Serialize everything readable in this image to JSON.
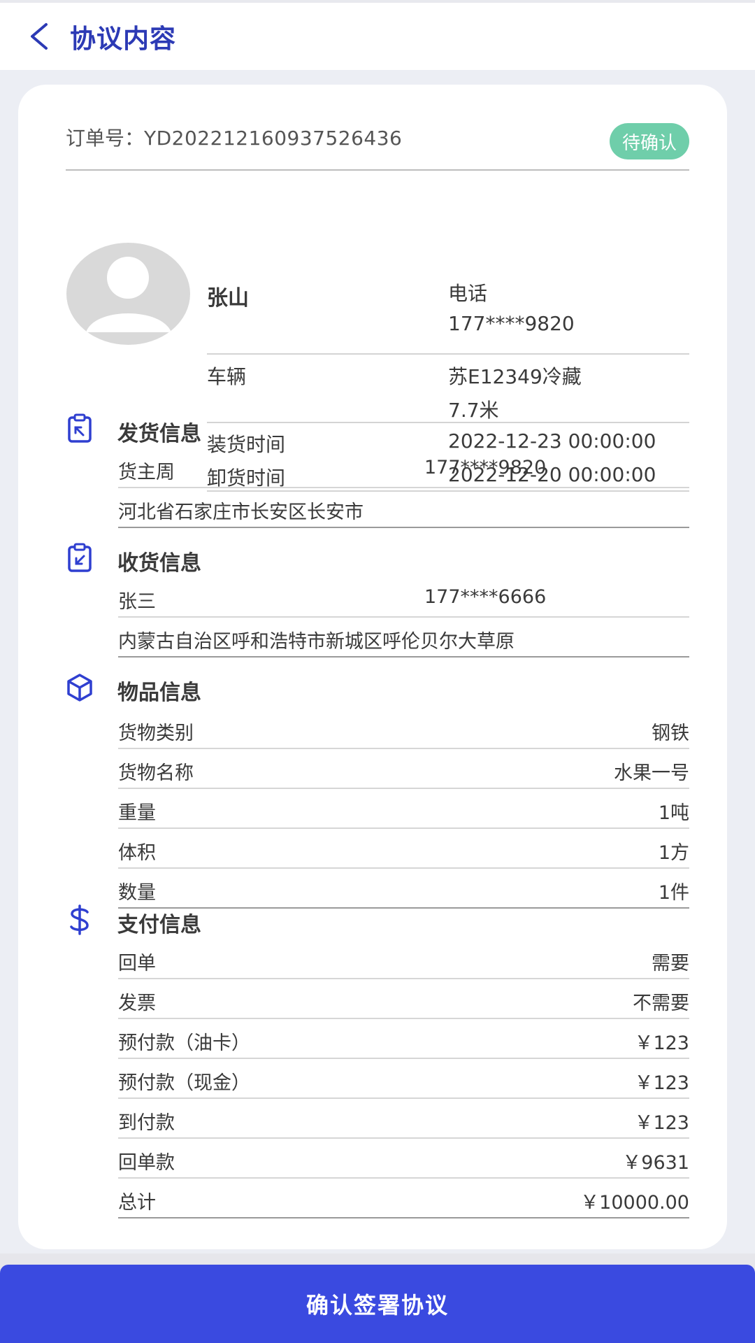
{
  "header": {
    "title": "协议内容"
  },
  "order": {
    "label": "订单号：",
    "number": "YD202212160937526436",
    "status": "待确认"
  },
  "driver": {
    "name": "张山",
    "phone_label": "电话",
    "phone": "177****9820",
    "vehicle_label": "车辆",
    "vehicle_plate": "苏E12349冷藏",
    "vehicle_length": "7.7米",
    "load_time_label": "装货时间",
    "load_time": "2022-12-23 00:00:00",
    "unload_time_label": "卸货时间",
    "unload_time": "2022-12-20 00:00:00"
  },
  "shipping": {
    "title": "发货信息",
    "name": "货主周",
    "phone": "177****9820",
    "address": "河北省石家庄市长安区长安市"
  },
  "receiving": {
    "title": "收货信息",
    "name": "张三",
    "phone": "177****6666",
    "address": "内蒙古自治区呼和浩特市新城区呼伦贝尔大草原"
  },
  "goods": {
    "title": "物品信息",
    "rows": [
      {
        "label": "货物类别",
        "value": "钢铁"
      },
      {
        "label": "货物名称",
        "value": "水果一号"
      },
      {
        "label": "重量",
        "value": "1吨"
      },
      {
        "label": "体积",
        "value": "1方"
      },
      {
        "label": "数量",
        "value": "1件"
      }
    ]
  },
  "payment": {
    "title": "支付信息",
    "rows": [
      {
        "label": "回单",
        "value": "需要"
      },
      {
        "label": "发票",
        "value": "不需要"
      },
      {
        "label": "预付款（油卡）",
        "value": "￥123"
      },
      {
        "label": "预付款（现金）",
        "value": "￥123"
      },
      {
        "label": "到付款",
        "value": "￥123"
      },
      {
        "label": "回单款",
        "value": "￥9631"
      },
      {
        "label": "总计",
        "value": "￥10000.00"
      }
    ]
  },
  "footer": {
    "confirm_label": "确认签署协议"
  },
  "colors": {
    "accent": "#3a4ae0",
    "title": "#2c3ab5",
    "badge": "#6fceaa",
    "icon": "#2f3fd0"
  }
}
